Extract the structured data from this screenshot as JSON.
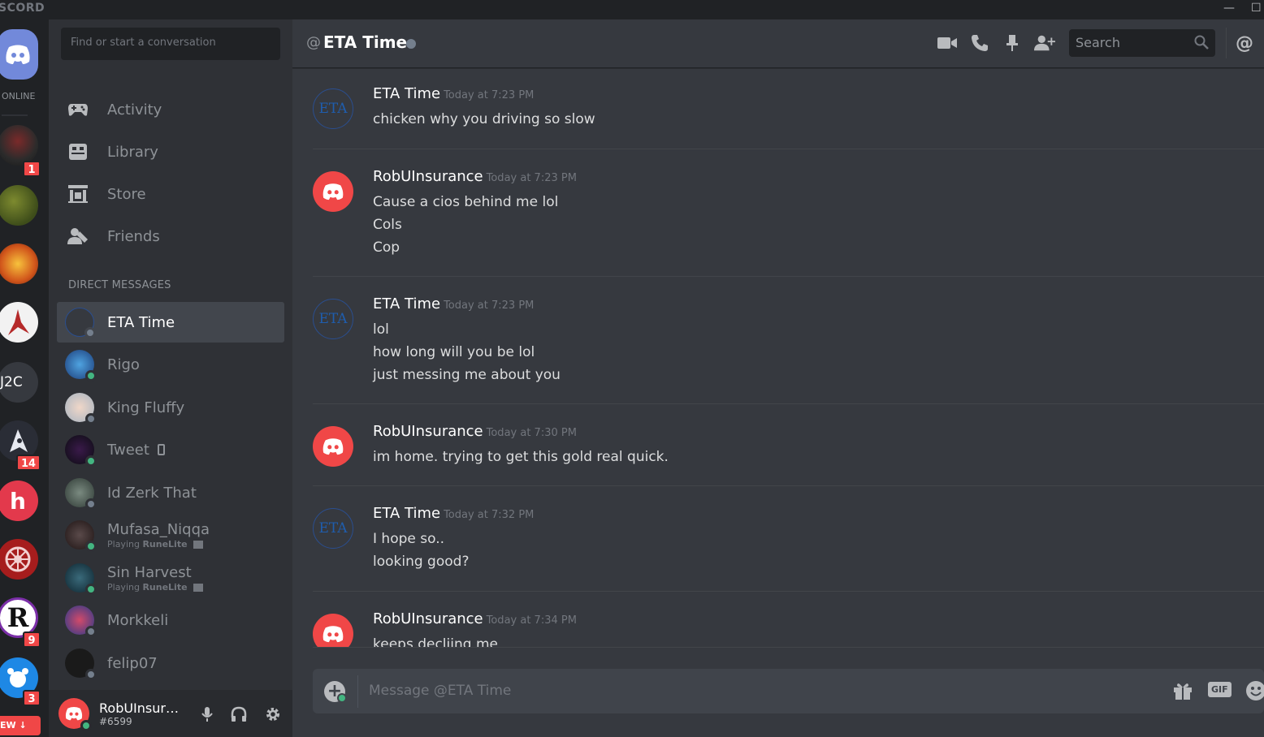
{
  "window": {
    "brand": "SCORD",
    "minimize": "—",
    "maximize": "☐"
  },
  "guilds": {
    "online_label": "ONLINE",
    "badges": [
      "1",
      "14",
      "9",
      "3"
    ],
    "j2c_label": "J2C",
    "new_label": "EW ↓",
    "colors": {
      "blurple": "#7289da",
      "red": "#f04747",
      "green": "#43b581"
    }
  },
  "sidebar": {
    "search_placeholder": "Find or start a conversation",
    "nav": [
      {
        "label": "Activity",
        "icon": "gamepad-icon"
      },
      {
        "label": "Library",
        "icon": "library-icon"
      },
      {
        "label": "Store",
        "icon": "store-icon"
      },
      {
        "label": "Friends",
        "icon": "friends-icon"
      }
    ],
    "dm_header": "DIRECT MESSAGES",
    "dms": [
      {
        "name": "ETA Time",
        "status": "offline",
        "active": true
      },
      {
        "name": "Rigo",
        "status": "online"
      },
      {
        "name": "King Fluffy",
        "status": "offline"
      },
      {
        "name": "Tweet",
        "status": "online",
        "mobile": true
      },
      {
        "name": "Id Zerk That",
        "status": "offline"
      },
      {
        "name": "Mufasa_Niqqa",
        "status": "online",
        "activity_prefix": "Playing",
        "activity_game": "RuneLite"
      },
      {
        "name": "Sin Harvest",
        "status": "online",
        "activity_prefix": "Playing",
        "activity_game": "RuneLite"
      },
      {
        "name": "Morkkeli",
        "status": "offline"
      },
      {
        "name": "felip07",
        "status": "offline"
      }
    ]
  },
  "user": {
    "name": "RobUInsura...",
    "tag": "#6599"
  },
  "chat": {
    "header_prefix": "@",
    "title": "ETA Time",
    "search_placeholder": "Search",
    "messages": [
      {
        "author": "ETA Time",
        "time": "Today at 7:23 PM",
        "avatar": "eta",
        "lines": [
          "chicken why you driving so slow"
        ]
      },
      {
        "author": "RobUInsurance",
        "time": "Today at 7:23 PM",
        "avatar": "rob",
        "lines": [
          "Cause a cios behind me lol",
          "Cols",
          "Cop"
        ]
      },
      {
        "author": "ETA Time",
        "time": "Today at 7:23 PM",
        "avatar": "eta",
        "lines": [
          "lol",
          "how long will you be lol",
          "just messing me about you"
        ]
      },
      {
        "author": "RobUInsurance",
        "time": "Today at 7:30 PM",
        "avatar": "rob",
        "lines": [
          "im home. trying to get this gold real quick."
        ]
      },
      {
        "author": "ETA Time",
        "time": "Today at 7:32 PM",
        "avatar": "eta",
        "lines": [
          "I hope so..",
          "looking good?"
        ]
      },
      {
        "author": "RobUInsurance",
        "time": "Today at 7:34 PM",
        "avatar": "rob",
        "lines": [
          "keeps decliing me"
        ]
      }
    ],
    "composer_placeholder": "Message @ETA Time",
    "gif_label": "GIF",
    "eta_avatar_text": "ETA"
  }
}
